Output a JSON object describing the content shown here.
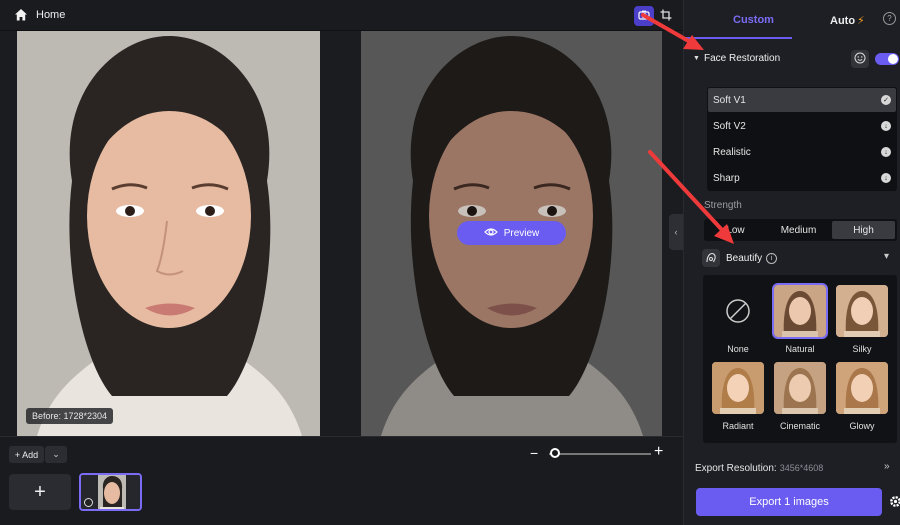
{
  "header": {
    "home_label": "Home"
  },
  "canvas": {
    "before_badge": "Before: 1728*2304",
    "preview_label": "Preview"
  },
  "bottom": {
    "add_label": "Add",
    "zoom_level": 0.05
  },
  "panel": {
    "tabs": [
      {
        "label": "Custom",
        "active": true
      },
      {
        "label": "Auto",
        "active": false
      }
    ],
    "face_restoration": {
      "title": "Face Restoration",
      "enabled": true,
      "models": [
        {
          "label": "Soft V1",
          "selected": true,
          "icon": "check-icon"
        },
        {
          "label": "Soft V2",
          "selected": false,
          "icon": "download-icon"
        },
        {
          "label": "Realistic",
          "selected": false,
          "icon": "download-icon"
        },
        {
          "label": "Sharp",
          "selected": false,
          "icon": "download-icon"
        }
      ]
    },
    "strength": {
      "label": "Strength",
      "options": [
        "Low",
        "Medium",
        "High"
      ],
      "selected": "High"
    },
    "beautify": {
      "title": "Beautify",
      "styles": [
        {
          "label": "None",
          "selected": false
        },
        {
          "label": "Natural",
          "selected": true
        },
        {
          "label": "Silky",
          "selected": false
        },
        {
          "label": "Radiant",
          "selected": false
        },
        {
          "label": "Cinematic",
          "selected": false
        },
        {
          "label": "Glowy",
          "selected": false
        }
      ]
    },
    "export": {
      "resolution_label": "Export Resolution:",
      "resolution_value": "3456*4608",
      "button_label": "Export 1 images"
    }
  },
  "colors": {
    "accent": "#6a5cf0",
    "annotation_arrow": "#ee3a3a"
  }
}
